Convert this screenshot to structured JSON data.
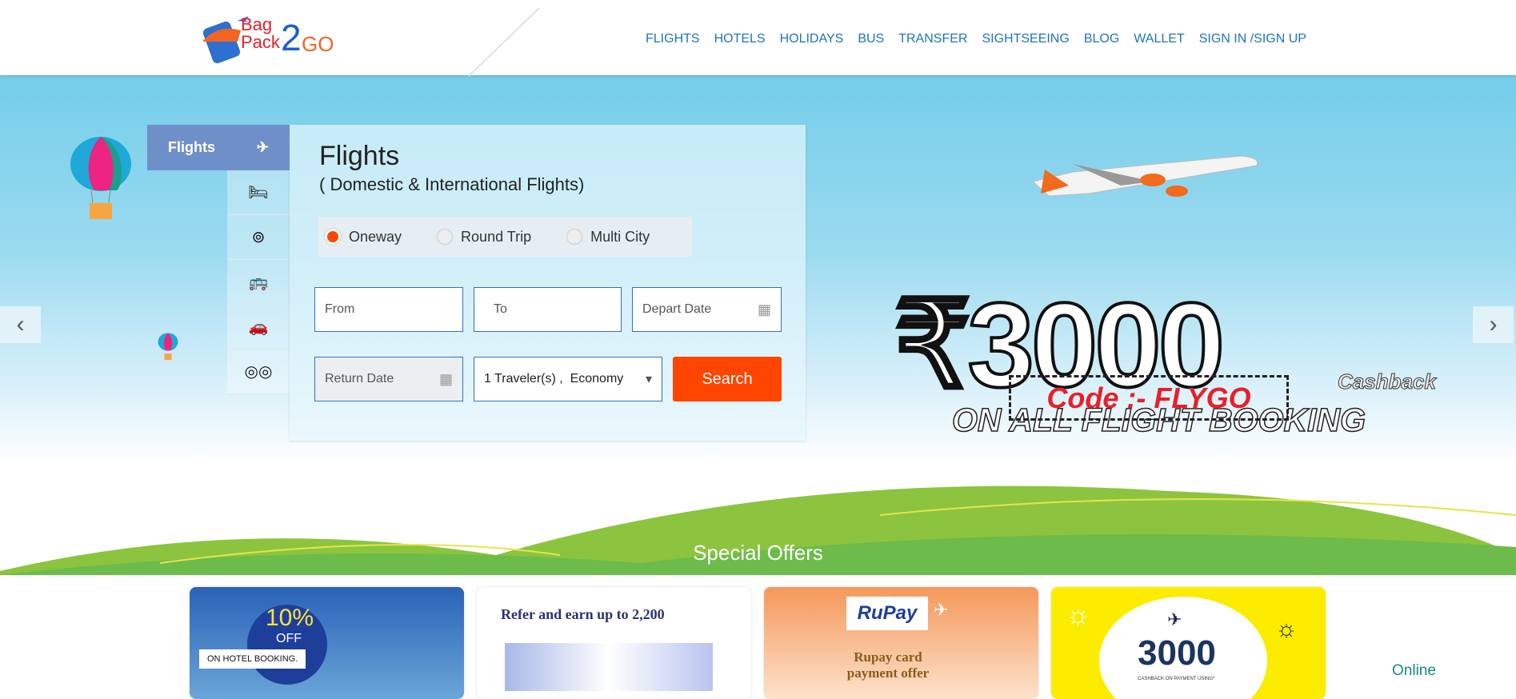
{
  "logo": {
    "line1": "Bag",
    "line2": "Pack",
    "two": "2",
    "go": "GO"
  },
  "nav": [
    "FLIGHTS",
    "HOTELS",
    "HOLIDAYS",
    "BUS",
    "TRANSFER",
    "SIGHTSEEING",
    "BLOG",
    "WALLET",
    "SIGN IN /SIGN UP"
  ],
  "tabs": {
    "active": "Flights",
    "icons": [
      "hotel-icon",
      "holiday-icon",
      "bus-icon",
      "car-icon",
      "sightseeing-icon"
    ]
  },
  "panel": {
    "title": "Flights",
    "subtitle": "( Domestic & International Flights)",
    "trip_types": [
      {
        "label": "Oneway",
        "selected": true
      },
      {
        "label": "Round Trip",
        "selected": false
      },
      {
        "label": "Multi City",
        "selected": false
      }
    ],
    "from_placeholder": "From",
    "to_placeholder": "To",
    "depart_placeholder": "Depart Date",
    "return_placeholder": "Return Date",
    "travelers": "1 Traveler(s) ,  Economy",
    "search_label": "Search"
  },
  "banner": {
    "amount": "₹3000",
    "cashback": "Cashback",
    "tagline": "ON ALL FLIGHT BOOKING",
    "code": "Code :- FLYGO"
  },
  "offers": {
    "title": "Special Offers",
    "cards": [
      {
        "pct": "10%",
        "off": "OFF",
        "text": "ON HOTEL BOOKING."
      },
      {
        "text": "Refer and earn up to 2,200"
      },
      {
        "brand": "RuPay",
        "text": "Rupay card payment offer"
      },
      {
        "amount": "3000",
        "text": "CASHBACK ON PAYMENT USING*"
      }
    ]
  },
  "chat_status": "Online",
  "colors": {
    "accent": "#ff4500",
    "nav": "#1e73be",
    "tab": "#6f8fc8",
    "sky": "#74cde9"
  }
}
